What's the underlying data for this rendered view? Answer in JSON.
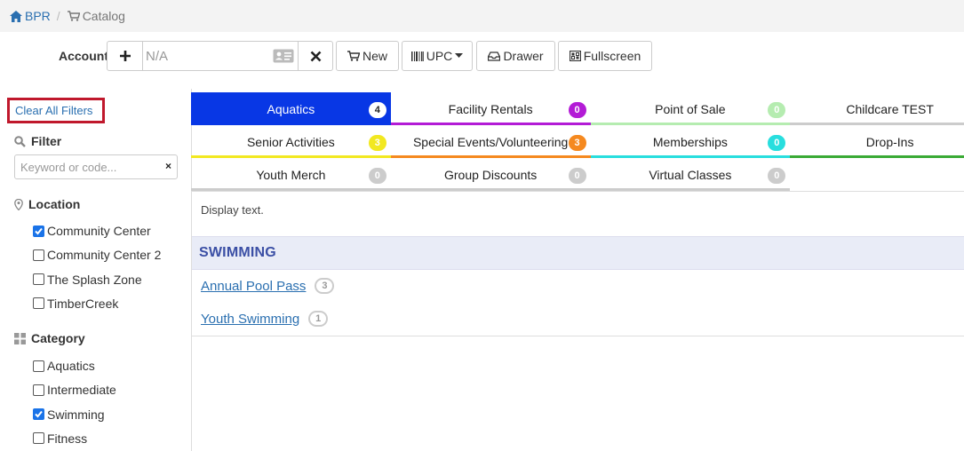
{
  "breadcrumb": {
    "home": "BPR",
    "separator": "/",
    "current": "Catalog"
  },
  "account": {
    "label": "Account",
    "placeholder": "N/A"
  },
  "toolbar": {
    "new": "New",
    "upc": "UPC",
    "drawer": "Drawer",
    "fullscreen": "Fullscreen"
  },
  "sidebar": {
    "clear_filters": "Clear All Filters",
    "filter_heading": "Filter",
    "keyword_placeholder": "Keyword or code...",
    "keyword_clear": "×",
    "location_heading": "Location",
    "locations": [
      {
        "label": "Community Center",
        "checked": true
      },
      {
        "label": "Community Center 2",
        "checked": false
      },
      {
        "label": "The Splash Zone",
        "checked": false
      },
      {
        "label": "TimberCreek",
        "checked": false
      }
    ],
    "category_heading": "Category",
    "categories": [
      {
        "label": "Aquatics",
        "checked": false
      },
      {
        "label": "Intermediate",
        "checked": false
      },
      {
        "label": "Swimming",
        "checked": true
      },
      {
        "label": "Fitness",
        "checked": false
      }
    ]
  },
  "tabs": [
    {
      "label": "Aquatics",
      "count": "4",
      "color": "#0837e5",
      "badge_color": "#ffffff",
      "active": true
    },
    {
      "label": "Facility Rentals",
      "count": "0",
      "color": "#b31bd6",
      "badge_color": "#b31bd6"
    },
    {
      "label": "Point of Sale",
      "count": "0",
      "color": "#b5ecb0",
      "badge_color": "#b5ecb0"
    },
    {
      "label": "Childcare TEST",
      "count": "",
      "color": "#cccccc",
      "badge_color": ""
    },
    {
      "label": "Senior Activities",
      "count": "3",
      "color": "#f2e820",
      "badge_color": "#f2e820"
    },
    {
      "label": "Special Events/Volunteering",
      "count": "3",
      "color": "#f5891f",
      "badge_color": "#f5891f"
    },
    {
      "label": "Memberships",
      "count": "0",
      "color": "#28dede",
      "badge_color": "#28dede"
    },
    {
      "label": "Drop-Ins",
      "count": "",
      "color": "#3aaa35",
      "badge_color": ""
    },
    {
      "label": "Youth Merch",
      "count": "0",
      "color": "#cccccc",
      "badge_color": "#cccccc"
    },
    {
      "label": "Group Discounts",
      "count": "0",
      "color": "#cccccc",
      "badge_color": "#cccccc"
    },
    {
      "label": "Virtual Classes",
      "count": "0",
      "color": "#cccccc",
      "badge_color": "#cccccc"
    }
  ],
  "content": {
    "display_text": "Display text.",
    "section_title": "SWIMMING",
    "items": [
      {
        "label": "Annual Pool Pass",
        "count": "3"
      },
      {
        "label": "Youth Swimming",
        "count": "1"
      }
    ]
  }
}
